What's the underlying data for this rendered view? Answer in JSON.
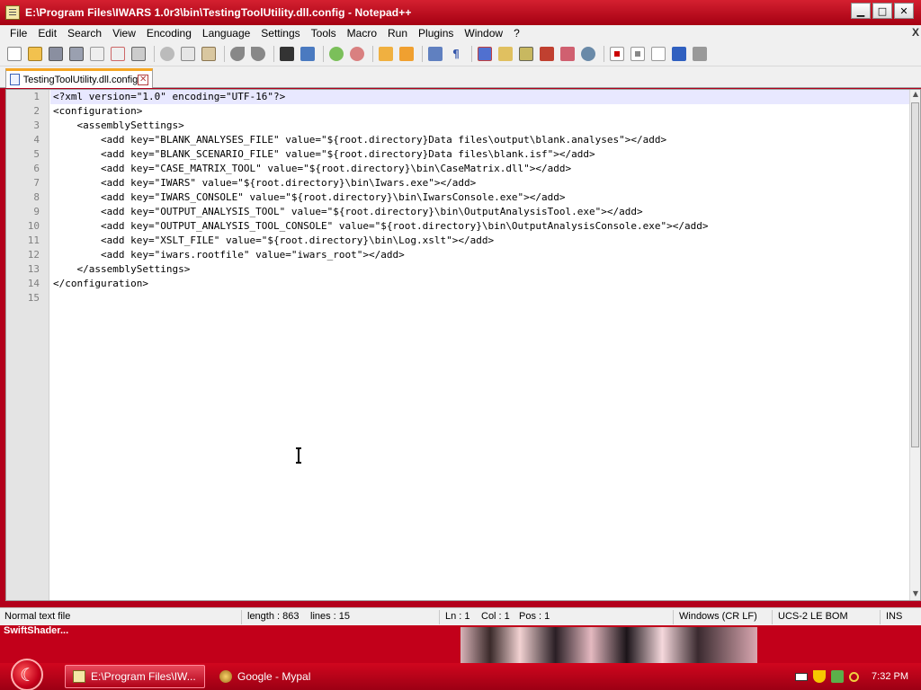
{
  "window": {
    "title": "E:\\Program Files\\IWARS 1.0r3\\bin\\TestingToolUtility.dll.config - Notepad++",
    "controls": [
      "minimize",
      "maximize",
      "close"
    ]
  },
  "menu": {
    "items": [
      "File",
      "Edit",
      "Search",
      "View",
      "Encoding",
      "Language",
      "Settings",
      "Tools",
      "Macro",
      "Run",
      "Plugins",
      "Window",
      "?"
    ],
    "close_label": "X"
  },
  "toolbar": {
    "icons": [
      "new-file-icon",
      "open-file-icon",
      "save-icon",
      "save-all-icon",
      "close-icon",
      "close-all-icon",
      "print-icon",
      "cut-icon",
      "copy-icon",
      "paste-icon",
      "undo-icon",
      "redo-icon",
      "find-icon",
      "replace-icon",
      "zoom-in-icon",
      "zoom-out-icon",
      "sync-vertical-icon",
      "sync-horizontal-icon",
      "word-wrap-icon",
      "show-all-chars-icon",
      "indent-guide-icon",
      "user-lang-icon",
      "doc-map-icon",
      "function-list-icon",
      "folder-workspace-icon",
      "monitor-icon",
      "record-macro-icon",
      "stop-macro-icon",
      "play-macro-icon",
      "run-macro-multiple-icon",
      "save-macro-icon"
    ]
  },
  "tab": {
    "label": "TestingToolUtility.dll.config"
  },
  "editor": {
    "lines": [
      "<?xml version=\"1.0\" encoding=\"UTF-16\"?>",
      "<configuration>",
      "    <assemblySettings>",
      "        <add key=\"BLANK_ANALYSES_FILE\" value=\"${root.directory}Data files\\output\\blank.analyses\"></add>",
      "        <add key=\"BLANK_SCENARIO_FILE\" value=\"${root.directory}Data files\\blank.isf\"></add>",
      "        <add key=\"CASE_MATRIX_TOOL\" value=\"${root.directory}\\bin\\CaseMatrix.dll\"></add>",
      "        <add key=\"IWARS\" value=\"${root.directory}\\bin\\Iwars.exe\"></add>",
      "        <add key=\"IWARS_CONSOLE\" value=\"${root.directory}\\bin\\IwarsConsole.exe\"></add>",
      "        <add key=\"OUTPUT_ANALYSIS_TOOL\" value=\"${root.directory}\\bin\\OutputAnalysisTool.exe\"></add>",
      "        <add key=\"OUTPUT_ANALYSIS_TOOL_CONSOLE\" value=\"${root.directory}\\bin\\OutputAnalysisConsole.exe\"></add>",
      "        <add key=\"XSLT_FILE\" value=\"${root.directory}\\bin\\Log.xslt\"></add>",
      "        <add key=\"iwars.rootfile\" value=\"iwars_root\"></add>",
      "    </assemblySettings>",
      "</configuration>",
      ""
    ],
    "line_numbers": [
      "1",
      "2",
      "3",
      "4",
      "5",
      "6",
      "7",
      "8",
      "9",
      "10",
      "11",
      "12",
      "13",
      "14",
      "15"
    ],
    "current_line": 1
  },
  "status": {
    "file_type": "Normal text file",
    "length": "length : 863",
    "lines": "lines : 15",
    "ln": "Ln : 1",
    "col": "Col : 1",
    "pos": "Pos : 1",
    "eol": "Windows (CR LF)",
    "encoding": "UCS-2 LE BOM",
    "mode": "INS"
  },
  "desktop": {
    "label": "SwiftShader..."
  },
  "taskbar": {
    "buttons": [
      {
        "label": "E:\\Program Files\\IW...",
        "icon": "notepadpp-icon",
        "active": true
      },
      {
        "label": "Google - Mypal",
        "icon": "mypal-browser-icon",
        "active": false
      }
    ],
    "tray_icons": [
      "keyboard-icon",
      "shield-icon",
      "network-icon",
      "search-icon"
    ],
    "clock": "7:32 PM"
  },
  "colors": {
    "title_bar": "#c4001a",
    "taskbar": "#c4001a",
    "current_line": "#e8e8ff",
    "tab_accent": "#f5a623"
  }
}
